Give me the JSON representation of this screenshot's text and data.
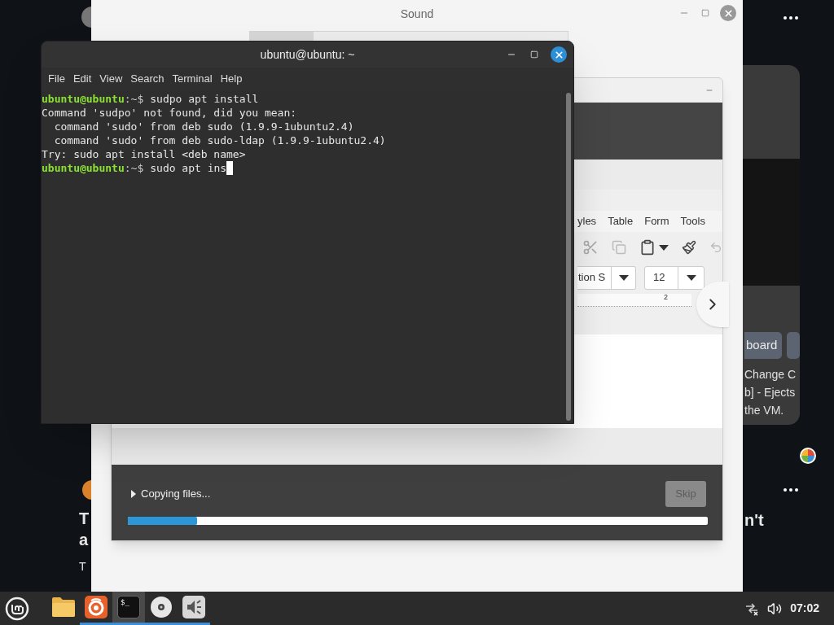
{
  "backdrop": {
    "left_texts": [
      "T",
      "a",
      "T"
    ],
    "right_text": "n't",
    "card_button": "board",
    "card_lines": [
      "Change C",
      "b] - Ejects",
      "the VM."
    ]
  },
  "sound_window": {
    "title": "Sound"
  },
  "installer": {
    "menu": [
      "yles",
      "Table",
      "Form",
      "Tools"
    ],
    "font_name": "tion S",
    "font_size": "12",
    "ruler_label": "2",
    "status": "Copying files...",
    "skip_button": {
      "label": "Skip",
      "disabled": true
    },
    "progress": {
      "level": 0.12
    }
  },
  "terminal": {
    "title": "ubuntu@ubuntu: ~",
    "menu": [
      "File",
      "Edit",
      "View",
      "Search",
      "Terminal",
      "Help"
    ],
    "lines": [
      {
        "kind": "prompt",
        "user": "ubuntu@ubuntu",
        "path": ":~$",
        "command": "sudpo apt install",
        "cursor": false
      },
      {
        "kind": "output",
        "text": "Command 'sudpo' not found, did you mean:"
      },
      {
        "kind": "output",
        "text": "  command 'sudo' from deb sudo (1.9.9-1ubuntu2.4)"
      },
      {
        "kind": "output",
        "text": "  command 'sudo' from deb sudo-ldap (1.9.9-1ubuntu2.4)"
      },
      {
        "kind": "output",
        "text": "Try: sudo apt install <deb name>"
      },
      {
        "kind": "prompt",
        "user": "ubuntu@ubuntu",
        "path": ":~$",
        "command": "sudo apt ins",
        "cursor": true
      }
    ]
  },
  "taskbar": {
    "apps": [
      {
        "kind": "files",
        "running": false,
        "focused": false
      },
      {
        "kind": "firefox",
        "running": true,
        "focused": false
      },
      {
        "kind": "terminal",
        "glyph": "$_",
        "running": true,
        "focused": true
      },
      {
        "kind": "disc",
        "running": true,
        "focused": false
      },
      {
        "kind": "sound",
        "running": true,
        "focused": false
      }
    ],
    "clock": "07:02"
  }
}
